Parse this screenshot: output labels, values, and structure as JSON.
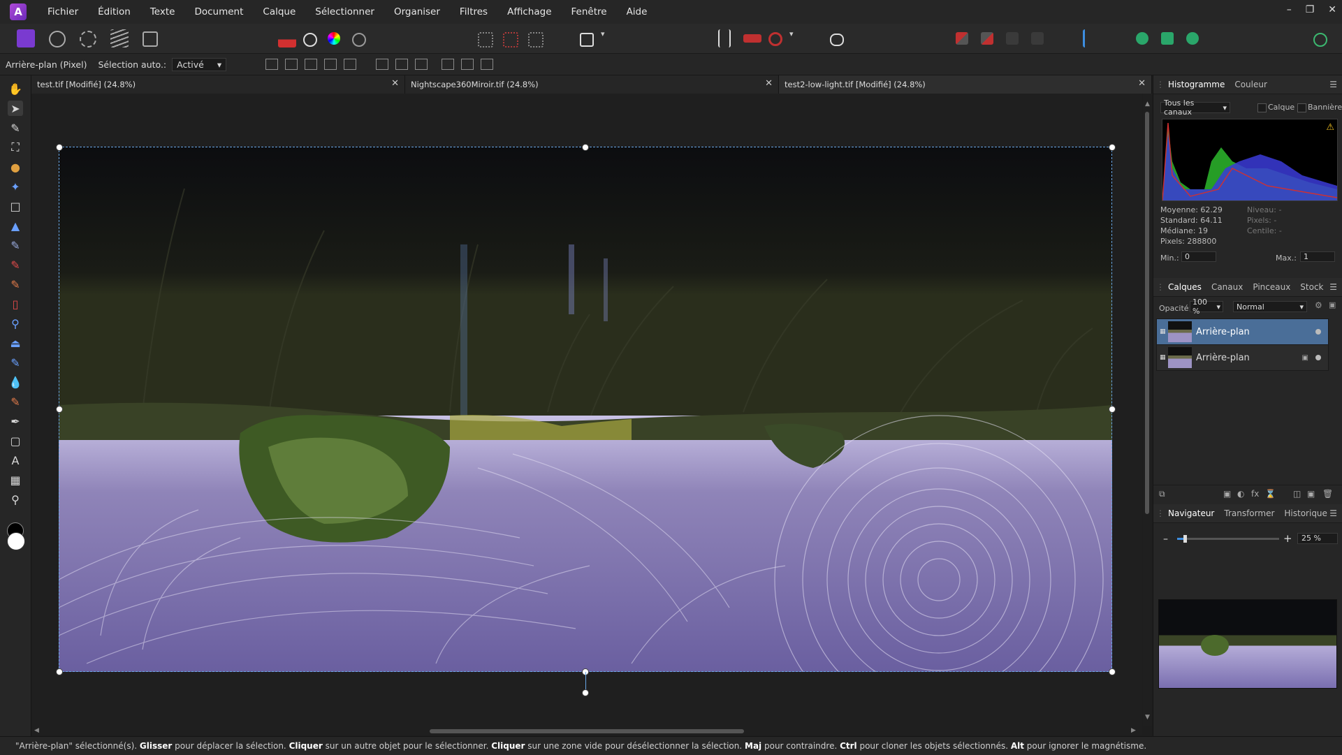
{
  "menu": [
    "Fichier",
    "Édition",
    "Texte",
    "Document",
    "Calque",
    "Sélectionner",
    "Organiser",
    "Filtres",
    "Affichage",
    "Fenêtre",
    "Aide"
  ],
  "context": {
    "layer_label": "Arrière-plan (Pixel)",
    "auto_select_label": "Sélection auto.:",
    "auto_select_value": "Activé"
  },
  "tabs": [
    {
      "label": "test.tif [Modifié] (24.8%)"
    },
    {
      "label": "Nightscape360Miroir.tif (24.8%)"
    },
    {
      "label": "test2-low-light.tif [Modifié] (24.8%)"
    }
  ],
  "histogram": {
    "tabs": [
      "Histogramme",
      "Couleur"
    ],
    "channel": "Tous les canaux",
    "check_layer": "Calque",
    "check_banner": "Bannière",
    "stats_left": [
      "Moyenne: 62.29",
      "Standard: 64.11",
      "Médiane: 19",
      "Pixels: 288800"
    ],
    "stats_right": [
      "Niveau: -",
      "Pixels: -",
      "Centile: -"
    ],
    "min_label": "Min.:",
    "min_value": "0",
    "max_label": "Max.:",
    "max_value": "1",
    "colors": {
      "red": "#d23030",
      "green": "#2db82d",
      "blue": "#3b3bd8"
    }
  },
  "layers": {
    "tabs": [
      "Calques",
      "Canaux",
      "Pinceaux",
      "Stock"
    ],
    "opacity_label": "Opacité:",
    "opacity_value": "100 %",
    "blend_mode": "Normal",
    "items": [
      {
        "name": "Arrière-plan",
        "selected": true
      },
      {
        "name": "Arrière-plan",
        "selected": false
      }
    ]
  },
  "navigator": {
    "tabs": [
      "Navigateur",
      "Transformer",
      "Historique"
    ],
    "zoom": "25 %",
    "zoom_fraction": 0.06
  },
  "status": [
    {
      "t": "\"Arrière-plan\" sélectionné(s). ",
      "b": false
    },
    {
      "t": "Glisser",
      "b": true
    },
    {
      "t": " pour déplacer la sélection. ",
      "b": false
    },
    {
      "t": "Cliquer",
      "b": true
    },
    {
      "t": " sur un autre objet pour le sélectionner. ",
      "b": false
    },
    {
      "t": "Cliquer",
      "b": true
    },
    {
      "t": " sur une zone vide pour désélectionner la sélection. ",
      "b": false
    },
    {
      "t": "Maj",
      "b": true
    },
    {
      "t": " pour contraindre. ",
      "b": false
    },
    {
      "t": "Ctrl",
      "b": true
    },
    {
      "t": " pour cloner les objets sélectionnés. ",
      "b": false
    },
    {
      "t": "Alt",
      "b": true
    },
    {
      "t": " pour ignorer le magnétisme.",
      "b": false
    }
  ],
  "accent": "#3d8ee0",
  "icons": {
    "logo": "affinity-photo-logo",
    "minimize": "minimize-icon",
    "maximize": "maximize-icon",
    "close": "close-icon"
  }
}
